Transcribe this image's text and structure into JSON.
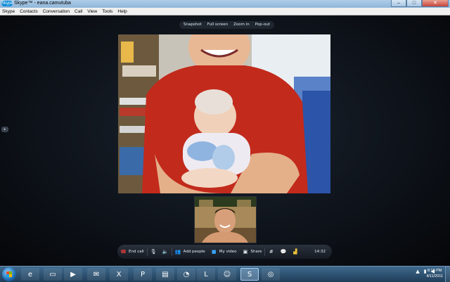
{
  "window": {
    "title": "Skype™ - eana.camutuba",
    "logo_text": "Skype",
    "minimize": "–",
    "maximize": "□",
    "close": "✕"
  },
  "menu": [
    "Skype",
    "Contacts",
    "Conversation",
    "Call",
    "View",
    "Tools",
    "Help"
  ],
  "video_toolbar": [
    "Snapshot",
    "Full screen",
    "Zoom in",
    "Pop-out"
  ],
  "controls": {
    "end_call": "End call",
    "add_people": "Add people",
    "my_video": "My video",
    "share": "Share",
    "duration": "14:32"
  },
  "taskbar": {
    "apps": [
      {
        "name": "internet-explorer-icon",
        "glyph": "e"
      },
      {
        "name": "folder-icon",
        "glyph": "▭"
      },
      {
        "name": "media-player-icon",
        "glyph": "▶"
      },
      {
        "name": "outlook-icon",
        "glyph": "✉"
      },
      {
        "name": "excel-icon",
        "glyph": "X"
      },
      {
        "name": "powerpoint-icon",
        "glyph": "P"
      },
      {
        "name": "document-icon",
        "glyph": "▤"
      },
      {
        "name": "paint-icon",
        "glyph": "◔"
      },
      {
        "name": "lync-icon",
        "glyph": "L"
      },
      {
        "name": "messenger-icon",
        "glyph": "☺"
      },
      {
        "name": "skype-icon",
        "glyph": "S"
      },
      {
        "name": "firefox-icon",
        "glyph": "◎"
      }
    ],
    "tray_show_hidden": "▲",
    "time": "8:16 PM",
    "date": "4/11/2011"
  },
  "colors": {
    "end_call": "#e03a3a",
    "accent": "#38a6ff",
    "shirt": "#c22a1c"
  }
}
